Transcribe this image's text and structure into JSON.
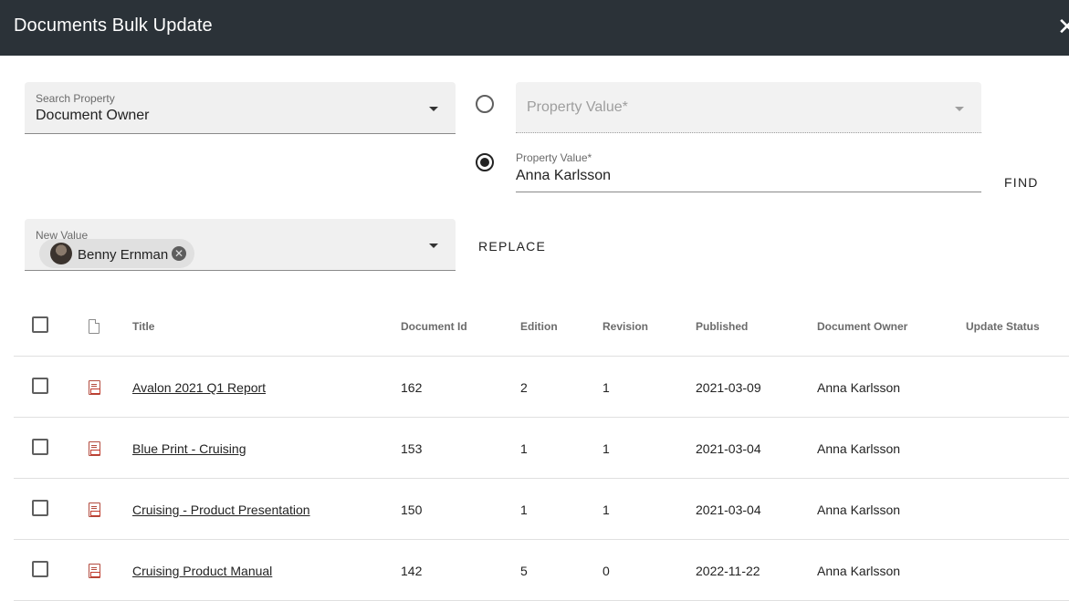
{
  "header": {
    "title": "Documents Bulk Update",
    "close_icon": "close-icon",
    "close_glyph": "✕"
  },
  "search_property": {
    "label": "Search Property",
    "value": "Document Owner"
  },
  "property_value_select": {
    "placeholder": "Property Value*",
    "selected": false
  },
  "property_value_text": {
    "label": "Property Value*",
    "value": "Anna Karlsson",
    "selected": true
  },
  "find_label": "FIND",
  "new_value": {
    "label": "New Value",
    "chip_label": "Benny Ernman",
    "chip_remove_glyph": "✕"
  },
  "replace_label": "REPLACE",
  "table": {
    "columns": {
      "title": "Title",
      "document_id": "Document Id",
      "edition": "Edition",
      "revision": "Revision",
      "published": "Published",
      "document_owner": "Document Owner",
      "update_status": "Update Status"
    },
    "rows": [
      {
        "title": "Avalon 2021 Q1 Report",
        "document_id": "162",
        "edition": "2",
        "revision": "1",
        "published": "2021-03-09",
        "document_owner": "Anna Karlsson",
        "update_status": ""
      },
      {
        "title": "Blue Print - Cruising",
        "document_id": "153",
        "edition": "1",
        "revision": "1",
        "published": "2021-03-04",
        "document_owner": "Anna Karlsson",
        "update_status": ""
      },
      {
        "title": "Cruising - Product Presentation",
        "document_id": "150",
        "edition": "1",
        "revision": "1",
        "published": "2021-03-04",
        "document_owner": "Anna Karlsson",
        "update_status": ""
      },
      {
        "title": "Cruising Product Manual",
        "document_id": "142",
        "edition": "5",
        "revision": "0",
        "published": "2022-11-22",
        "document_owner": "Anna Karlsson",
        "update_status": ""
      }
    ]
  },
  "colors": {
    "header_bg": "#2b3238",
    "field_bg": "#f0f0f0",
    "pdf_icon": "#b34b3e"
  }
}
